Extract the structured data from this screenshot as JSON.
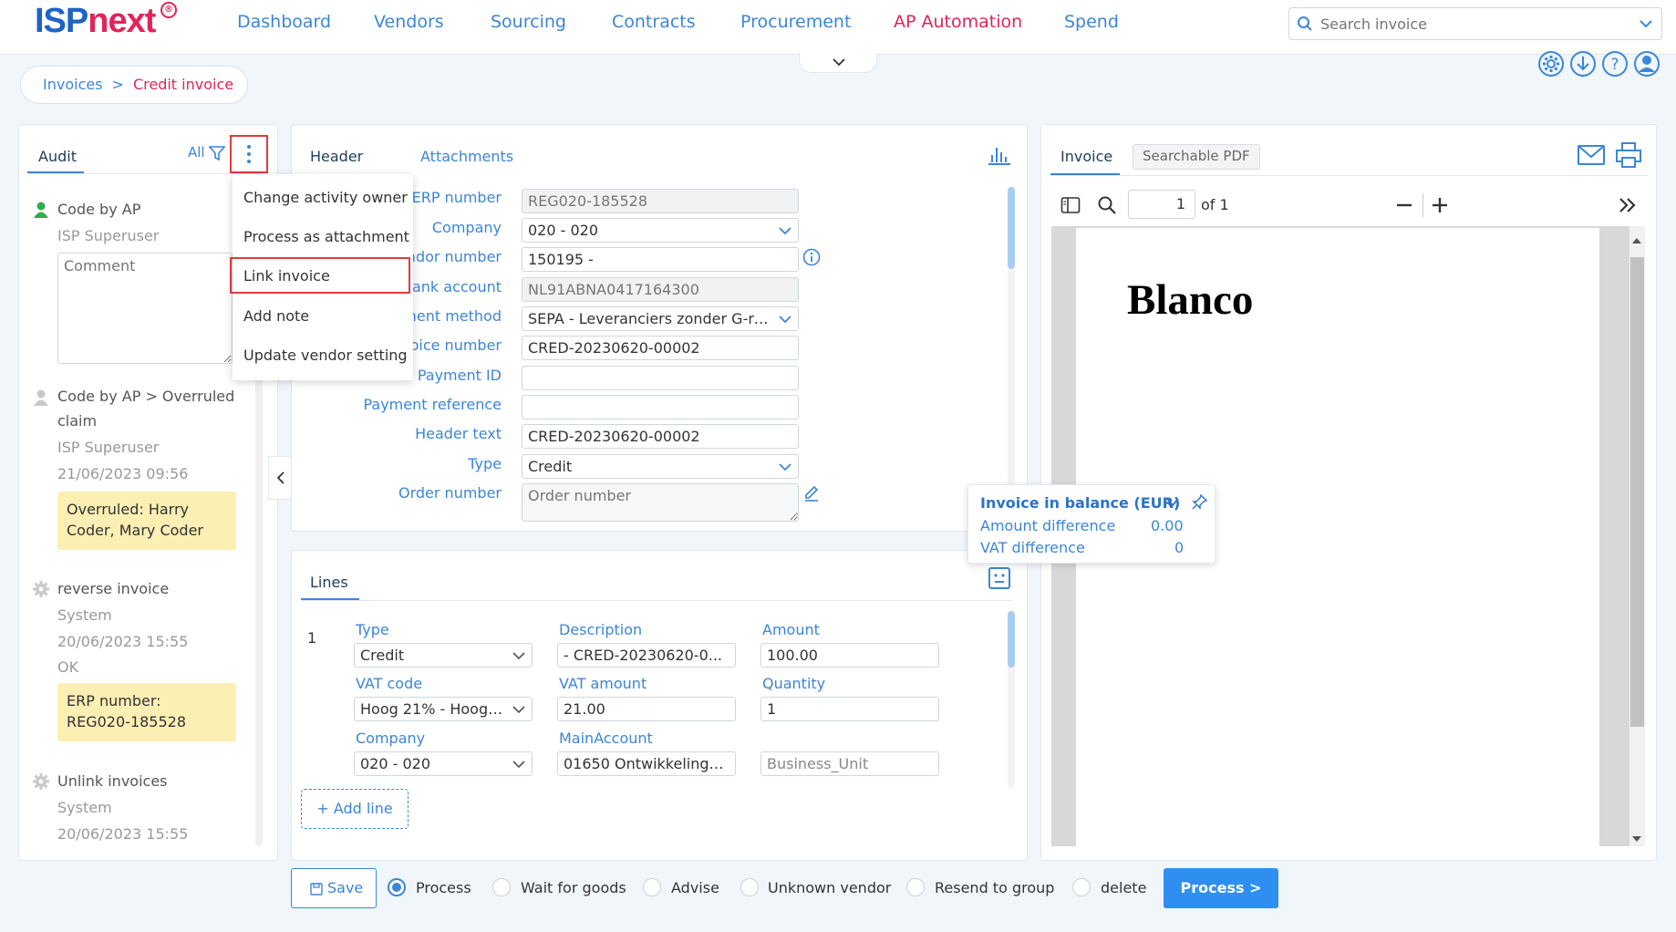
{
  "app": {
    "logo_isp": "ISP",
    "logo_next": "next",
    "logo_badge": "®"
  },
  "nav": {
    "items": [
      "Dashboard",
      "Vendors",
      "Sourcing",
      "Contracts",
      "Procurement",
      "AP Automation",
      "Spend"
    ],
    "active": "AP Automation"
  },
  "search": {
    "placeholder": "Search invoice"
  },
  "top_icons": [
    "settings-icon",
    "download-icon",
    "help-icon",
    "user-icon"
  ],
  "breadcrumb": {
    "parent": "Invoices",
    "separator": ">",
    "current": "Credit invoice"
  },
  "audit": {
    "tab": "Audit",
    "filter_label": "All",
    "comment_placeholder": "Comment",
    "entries": [
      {
        "title": "Code by AP",
        "user": "ISP Superuser"
      },
      {
        "title": "Code by AP > Overruled",
        "title2": "claim",
        "user": "ISP Superuser",
        "time": "21/06/2023 09:56",
        "note": "Overruled: Harry Coder, Mary Coder"
      },
      {
        "title": "reverse invoice",
        "user": "System",
        "time": "20/06/2023 15:55",
        "status": "OK",
        "note": "ERP number: REG020-185528"
      },
      {
        "title": "Unlink invoices",
        "user": "System",
        "time": "20/06/2023 15:55"
      }
    ]
  },
  "menu": {
    "items": [
      "Change activity owner",
      "Process as attachment",
      "Link invoice",
      "Add note",
      "Update vendor setting"
    ],
    "highlighted": "Link invoice"
  },
  "header_panel": {
    "tabs": [
      "Header",
      "Attachments"
    ],
    "fields": {
      "erp_number": {
        "label": "ERP number",
        "value": "REG020-185528"
      },
      "company": {
        "label": "Company",
        "value": "020 - 020"
      },
      "vendor_number": {
        "label": "ndor number",
        "value": "150195 -"
      },
      "bank_account": {
        "label": "Bank account",
        "value": "NL91ABNA0417164300"
      },
      "payment_method": {
        "label": "ment method",
        "value": "SEPA - Leveranciers zonder G-re..."
      },
      "invoice_number": {
        "label": "oice number",
        "value": "CRED-20230620-00002"
      },
      "payment_id": {
        "label": "Payment ID",
        "value": ""
      },
      "payment_reference": {
        "label": "Payment reference",
        "value": ""
      },
      "header_text": {
        "label": "Header text",
        "value": "CRED-20230620-00002"
      },
      "type": {
        "label": "Type",
        "value": "Credit"
      },
      "order_number": {
        "label": "Order number",
        "placeholder": "Order number"
      }
    }
  },
  "lines_panel": {
    "tab": "Lines",
    "line_no": "1",
    "labels": {
      "type": "Type",
      "description": "Description",
      "amount": "Amount",
      "vat_code": "VAT code",
      "vat_amount": "VAT amount",
      "quantity": "Quantity",
      "company": "Company",
      "main_account": "MainAccount"
    },
    "values": {
      "type": "Credit",
      "description": "- CRED-20230620-0...",
      "amount": "100.00",
      "vat_code": "Hoog 21% - Hoog ...",
      "vat_amount": "21.00",
      "quantity": "1",
      "company": "020 - 020",
      "main_account": "01650 Ontwikkelings...",
      "business_unit_placeholder": "Business_Unit"
    },
    "add_line": "+ Add line"
  },
  "balance": {
    "title": "Invoice in balance (EUR)",
    "amount_difference_label": "Amount difference",
    "amount_difference": "0.00",
    "vat_difference_label": "VAT difference",
    "vat_difference": "0"
  },
  "viewer": {
    "tabs": [
      "Invoice",
      "Searchable PDF"
    ],
    "page": "1",
    "of_pages": "of 1",
    "document_text": "Blanco"
  },
  "bottom": {
    "save": "Save",
    "options": [
      "Process",
      "Wait for goods",
      "Advise",
      "Unknown vendor",
      "Resend to group",
      "delete"
    ],
    "selected": "Process",
    "process_button": "Process >"
  },
  "colors": {
    "brand_blue": "#1e63c5",
    "accent_pink": "#e2245a",
    "link_blue": "#3b86d8",
    "primary_button": "#2f8ff0"
  }
}
